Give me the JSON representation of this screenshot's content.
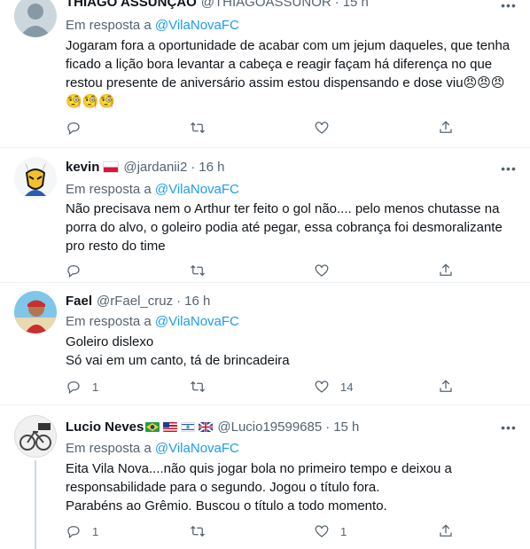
{
  "tweets": [
    {
      "name": "THIAGO ASSUNÇÃO",
      "handle": "@THIAGOASSUNOR",
      "time": "15 h",
      "reply_prefix": "Em resposta a",
      "reply_mention": "@VilaNovaFC",
      "lines": [
        "Jogaram fora a oportunidade de acabar com um jejum daqueles, que tenha",
        "ficado a lição bora levantar a cabeça e reagir façam há diferença no que",
        "restou presente de aniversário assim estou dispensando e dose viu😠😠😠",
        "🧐🧐🧐"
      ],
      "replies": "",
      "retweets": "",
      "likes": ""
    },
    {
      "name": "kevin",
      "handle": "@jardanii2",
      "time": "16 h",
      "reply_prefix": "Em resposta a",
      "reply_mention": "@VilaNovaFC",
      "lines": [
        "Não precisava nem o Arthur ter feito o gol não.... pelo menos chutasse na",
        "porra do alvo, o goleiro podia até pegar, essa cobrança foi desmoralizante",
        "pro resto do time"
      ],
      "replies": "",
      "retweets": "",
      "likes": ""
    },
    {
      "name": "Fael",
      "handle": "@rFael_cruz",
      "time": "16 h",
      "reply_prefix": "Em resposta a",
      "reply_mention": "@VilaNovaFC",
      "lines": [
        "Goleiro dislexo",
        "Só vai em um canto, tá de brincadeira"
      ],
      "replies": "1",
      "retweets": "",
      "likes": "14"
    },
    {
      "name": "Lucio Neves",
      "handle": "@Lucio19599685",
      "time": "15 h",
      "reply_prefix": "Em resposta a",
      "reply_mention": "@VilaNovaFC",
      "lines": [
        "Eita Vila Nova....não quis jogar bola no primeiro tempo e deixou a",
        "responsabilidade para o segundo.  Jogou o título fora.",
        "Parabéns ao Grêmio. Buscou o título a todo momento."
      ],
      "replies": "1",
      "retweets": "",
      "likes": "1"
    }
  ],
  "colors": {
    "link": "#1d9bf0",
    "secondary": "#536471",
    "text": "#0f1419"
  },
  "icons": [
    "reply-icon",
    "retweet-icon",
    "like-icon",
    "share-icon",
    "more-icon"
  ]
}
